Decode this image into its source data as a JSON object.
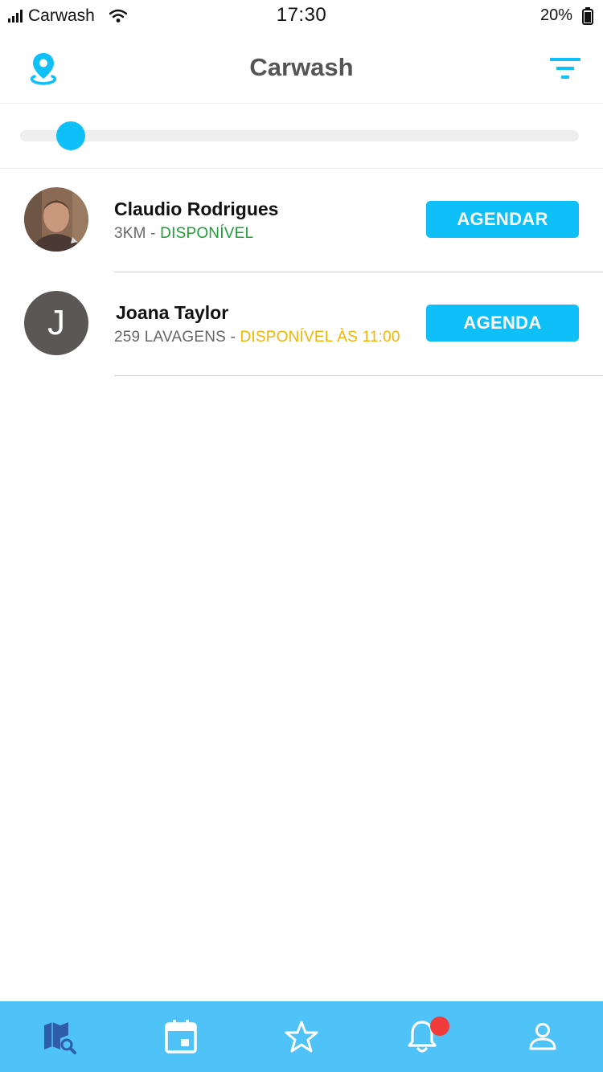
{
  "status_bar": {
    "carrier": "Carwash",
    "time": "17:30",
    "battery": "20%"
  },
  "header": {
    "title": "Carwash",
    "left_icon": "location-pin-icon",
    "right_icon": "filter-icon",
    "accent_color": "#0ec0f7"
  },
  "slider": {
    "value_fraction": 0.09
  },
  "list": {
    "items": [
      {
        "name": "Claudio Rodrigues",
        "meta_prefix": "3KM",
        "separator": " - ",
        "status": "DISPONÍVEL",
        "status_color": "#1ea039",
        "button_label": "AGENDAR",
        "avatar": "photo"
      },
      {
        "name": "Joana Taylor",
        "meta_prefix": "259 LAVAGENS",
        "separator": " - ",
        "status": "DISPONÍVEL ÀS 11:00",
        "status_color": "#f4b400",
        "button_label": "AGENDA",
        "avatar_letter": "J"
      }
    ]
  },
  "tab_bar": {
    "background": "#4fc3f7",
    "tabs": [
      {
        "icon": "map-search-icon",
        "active": true
      },
      {
        "icon": "calendar-icon",
        "active": false
      },
      {
        "icon": "star-icon",
        "active": false
      },
      {
        "icon": "bell-icon",
        "active": false,
        "badge": true
      },
      {
        "icon": "profile-icon",
        "active": false
      }
    ]
  }
}
